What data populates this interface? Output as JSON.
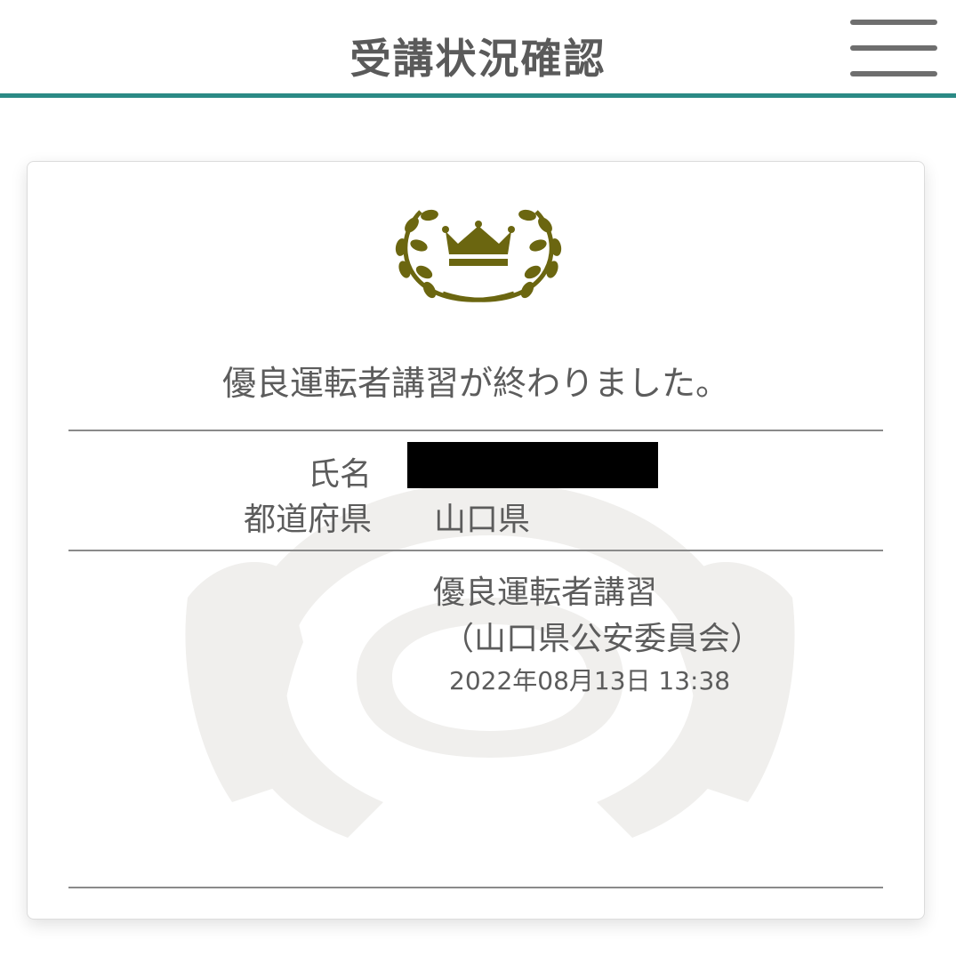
{
  "header": {
    "title": "受講状況確認",
    "menu_icon": "hamburger-menu-icon"
  },
  "card": {
    "emblem_icon": "laurel-crown-icon",
    "message": "優良運転者講習が終わりました。",
    "fields": [
      {
        "label": "氏名",
        "value": ""
      },
      {
        "label": "都道府県",
        "value": "山口県"
      }
    ],
    "course": {
      "name": "優良運転者講習",
      "issuer": "（山口県公安委員会）",
      "datetime": "2022年08月13日 13:38"
    },
    "watermark_icon": "steering-wheel-hands-icon"
  },
  "colors": {
    "accent": "#2b8a85",
    "emblem": "#6b6610",
    "text": "#5c5c5c",
    "watermark": "#f0efed"
  }
}
